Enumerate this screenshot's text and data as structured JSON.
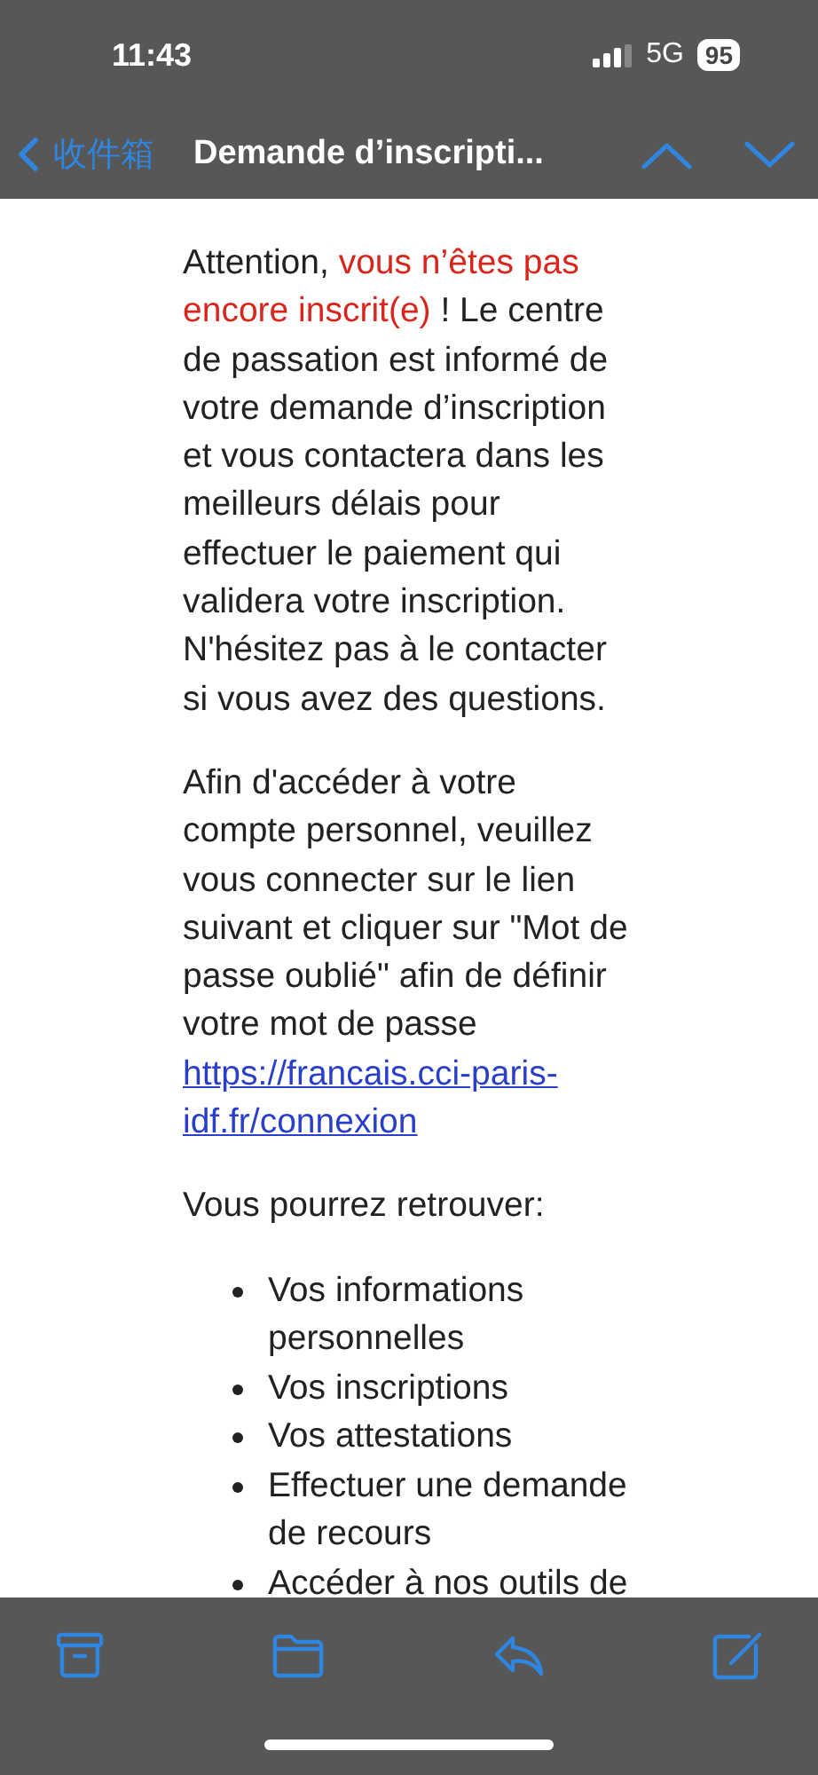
{
  "status_bar": {
    "time": "11:43",
    "network": "5G",
    "battery": "95"
  },
  "nav_bar": {
    "back_label": "收件箱",
    "title": "Demande d’inscripti..."
  },
  "message": {
    "paragraphs": [
      {
        "segments": [
          {
            "kind": "plain",
            "text": "Attention, "
          },
          {
            "kind": "alert",
            "text": "vous n’êtes pas encore inscrit(e)"
          },
          {
            "kind": "plain",
            "text": " ! Le centre de passation est informé de votre demande d’inscription et vous contactera dans les meilleurs délais pour effectuer le paiement qui validera votre inscription. N'hésitez pas à le contacter si vous avez des questions."
          }
        ]
      },
      {
        "segments": [
          {
            "kind": "plain",
            "text": "Afin d'accéder à votre compte personnel, veuillez vous connecter sur le lien suivant et cliquer sur \"Mot de passe oublié\" afin de définir votre mot de passe "
          },
          {
            "kind": "link",
            "text": "https://francais.cci-paris-idf.fr/connexion"
          }
        ]
      },
      {
        "segments": [
          {
            "kind": "plain",
            "text": "Vous pourrez retrouver:"
          }
        ]
      }
    ],
    "list": [
      "Vos informations personnelles",
      "Vos inscriptions",
      "Vos attestations",
      "Effectuer une demande de recours",
      "Accéder à nos outils de"
    ]
  },
  "toolbar": [
    {
      "kind": "archive"
    },
    {
      "kind": "folder"
    },
    {
      "kind": "reply"
    },
    {
      "kind": "compose"
    }
  ]
}
